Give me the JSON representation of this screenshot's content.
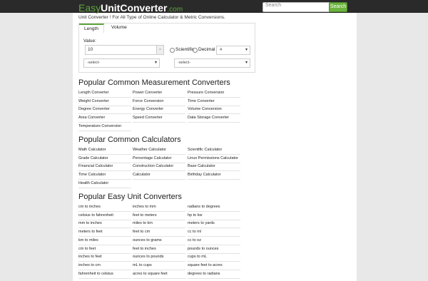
{
  "header": {
    "logo_easy": "Easy",
    "logo_unit": "UnitConverter",
    "logo_tld": ".com",
    "search_placeholder": "Search",
    "search_button": "Search"
  },
  "tagline": "Unit Converter ! For All Type of Online Calculator & Metric Conversions.",
  "converter": {
    "tabs": [
      "Length",
      "Volume"
    ],
    "value_label": "Value:",
    "value": "10",
    "swap_label": "=",
    "mode_scientific": "Scientific",
    "mode_decimal": "Decimal",
    "precision": "4",
    "from_select": "-select-",
    "to_select": "-select-"
  },
  "sections": [
    {
      "title": "Popular Common Measurement Converters",
      "items": [
        "Length Converter",
        "Power Converter",
        "Pressure Conversion",
        "Weight Converter",
        "Force Conversion",
        "Time Converter",
        "Degree Converter",
        "Energy Converter",
        "Volume Conversion",
        "Area Converter",
        "Speed Converter",
        "Data Storage Converter",
        "Temperature Conversion"
      ]
    },
    {
      "title": "Popular Common Calculators",
      "items": [
        "Math Calculator",
        "Weather Calculator",
        "Scientific Calculator",
        "Grade Calculator",
        "Percentage Calculator",
        "Linux Permissions Calculator",
        "Financial Calculator",
        "Construction Calculator",
        "Base Calculator",
        "Time Calculator",
        "Calculator",
        "Birthday Calculator",
        "Health Calculator"
      ]
    },
    {
      "title": "Popular Easy Unit Converters",
      "items": [
        "cm to inches",
        "inches to mm",
        "radians to degrees",
        "celsius to fahrenheit",
        "feet to meters",
        "hp to kw",
        "mm to inches",
        "miles to km",
        "meters to yards",
        "meters to feet",
        "feet to cm",
        "cc to ml",
        "km to miles",
        "ounces to grams",
        "cc to oz",
        "cm to feet",
        "feet to inches",
        "pounds to ounces",
        "inches to feet",
        "ounces to pounds",
        "cups to mL",
        "inches to cm",
        "mL to cups",
        "square feet to acres",
        "fahrenheit to celsius",
        "acres to square feet",
        "degrees to radians"
      ]
    }
  ]
}
